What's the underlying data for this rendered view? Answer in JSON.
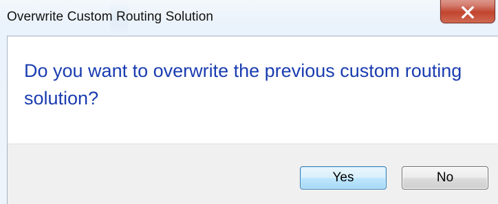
{
  "window": {
    "title": "Overwrite Custom Routing Solution",
    "close_icon": "close-icon"
  },
  "dialog": {
    "message": "Do you want to overwrite the previous custom routing solution?",
    "buttons": {
      "yes_label": "Yes",
      "no_label": "No"
    }
  },
  "colors": {
    "message_text": "#1a3cb0",
    "close_button": "#c2442f",
    "default_button_border": "#3c7fb1"
  }
}
